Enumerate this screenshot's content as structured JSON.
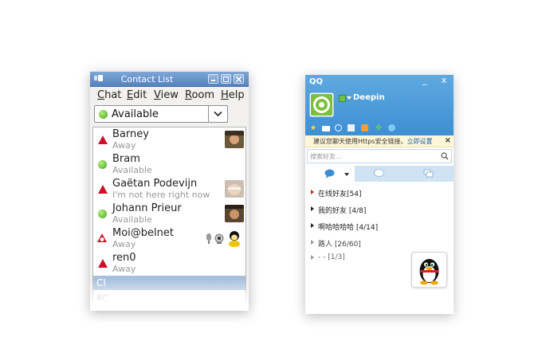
{
  "pidgin": {
    "title": "Contact List",
    "menu": [
      "Chat",
      "Edit",
      "View",
      "Room",
      "Help"
    ],
    "status": "Available",
    "buddies": [
      {
        "name": "Barney",
        "status": "Away",
        "state": "away"
      },
      {
        "name": "Bram",
        "status": "Available",
        "state": "available"
      },
      {
        "name": "Gaëtan Podevijn",
        "status": "I'm not here right now",
        "state": "away"
      },
      {
        "name": "Johann Prieur",
        "status": "Available",
        "state": "available"
      },
      {
        "name": "Moi@belnet",
        "status": "Away",
        "state": "away"
      },
      {
        "name": "ren0",
        "status": "Away",
        "state": "away"
      }
    ],
    "groups": [
      "CI",
      "FC"
    ],
    "colors": {
      "title_bar": "#5a88c4",
      "selected_group": "#a8c0dd",
      "away": "#d0102a",
      "available": "#3ea31b"
    }
  },
  "qq": {
    "title": "QQ",
    "min_glyph": "_",
    "close_glyph": "x",
    "nickname": "Deepin",
    "notice": "建议您聊天使用Https安全链接。",
    "notice_link": "立即设置",
    "search_placeholder": "搜索好友...",
    "groups": [
      {
        "label": "在线好友[54]"
      },
      {
        "label": "我的好友 [4/8]"
      },
      {
        "label": "啊哈哈哈哈 [4/14]"
      },
      {
        "label": "路人 [26/60]"
      },
      {
        "label": "- - [1/3]"
      }
    ],
    "colors": {
      "header": "#4a9ad8",
      "notice_bg": "#fff8d8",
      "tabs_bg": "#cfe3f4"
    }
  }
}
